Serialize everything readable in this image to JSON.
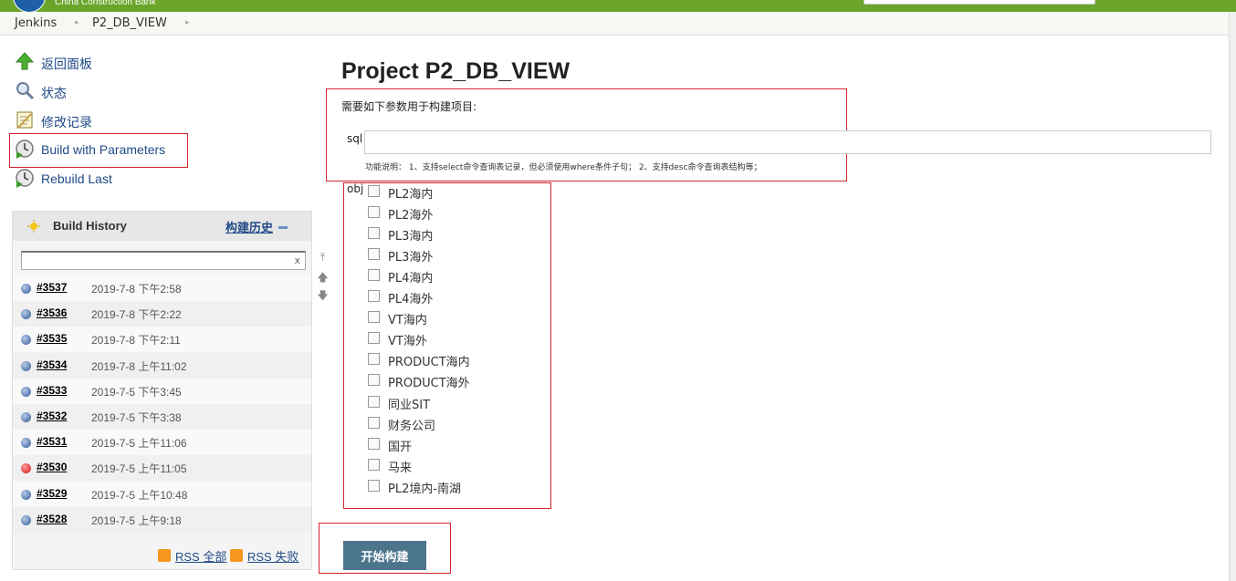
{
  "header": {
    "bank_name": "China Construction Bank",
    "breadcrumb": [
      "Jenkins",
      "P2_DB_VIEW"
    ]
  },
  "sidebar": {
    "tasks": [
      {
        "label": "返回面板",
        "icon": "up-arrow-icon"
      },
      {
        "label": "状态",
        "icon": "magnifier-icon"
      },
      {
        "label": "修改记录",
        "icon": "notepad-icon"
      },
      {
        "label": "Build with Parameters",
        "icon": "build-clock-icon"
      },
      {
        "label": "Rebuild Last",
        "icon": "build-clock-icon"
      }
    ]
  },
  "build_history": {
    "title": "Build History",
    "link_label": "构建历史",
    "filter_clear": "x",
    "builds": [
      {
        "num": "#3537",
        "date": "2019-7-8 下午2:58",
        "status": "blue"
      },
      {
        "num": "#3536",
        "date": "2019-7-8 下午2:22",
        "status": "blue"
      },
      {
        "num": "#3535",
        "date": "2019-7-8 下午2:11",
        "status": "blue"
      },
      {
        "num": "#3534",
        "date": "2019-7-8 上午11:02",
        "status": "blue"
      },
      {
        "num": "#3533",
        "date": "2019-7-5 下午3:45",
        "status": "blue"
      },
      {
        "num": "#3532",
        "date": "2019-7-5 下午3:38",
        "status": "blue"
      },
      {
        "num": "#3531",
        "date": "2019-7-5 上午11:06",
        "status": "blue"
      },
      {
        "num": "#3530",
        "date": "2019-7-5 上午11:05",
        "status": "red"
      },
      {
        "num": "#3529",
        "date": "2019-7-5 上午10:48",
        "status": "blue"
      },
      {
        "num": "#3528",
        "date": "2019-7-5 上午9:18",
        "status": "blue"
      }
    ],
    "rss_all": "RSS 全部",
    "rss_failed": "RSS 失败"
  },
  "main": {
    "title": "Project P2_DB_VIEW",
    "description": "需要如下参数用于构建项目:",
    "sql_label": "sql",
    "sql_value": "",
    "sql_help": "功能说明： 1、支持select命令查询表记录，但必须使用where条件子句； 2、支持desc命令查询表结构等；",
    "obj_label": "obj",
    "obj_options": [
      "PL2海内",
      "PL2海外",
      "PL3海内",
      "PL3海外",
      "PL4海内",
      "PL4海外",
      "VT海内",
      "VT海外",
      "PRODUCT海内",
      "PRODUCT海外",
      "同业SIT",
      "财务公司",
      "国开",
      "马来",
      "PL2境内-南湖"
    ],
    "build_button": "开始构建"
  },
  "colors": {
    "header_green": "#6aa52a",
    "highlight_red": "#d2242b",
    "build_button": "#4b758b",
    "link_blue": "#204a87"
  }
}
